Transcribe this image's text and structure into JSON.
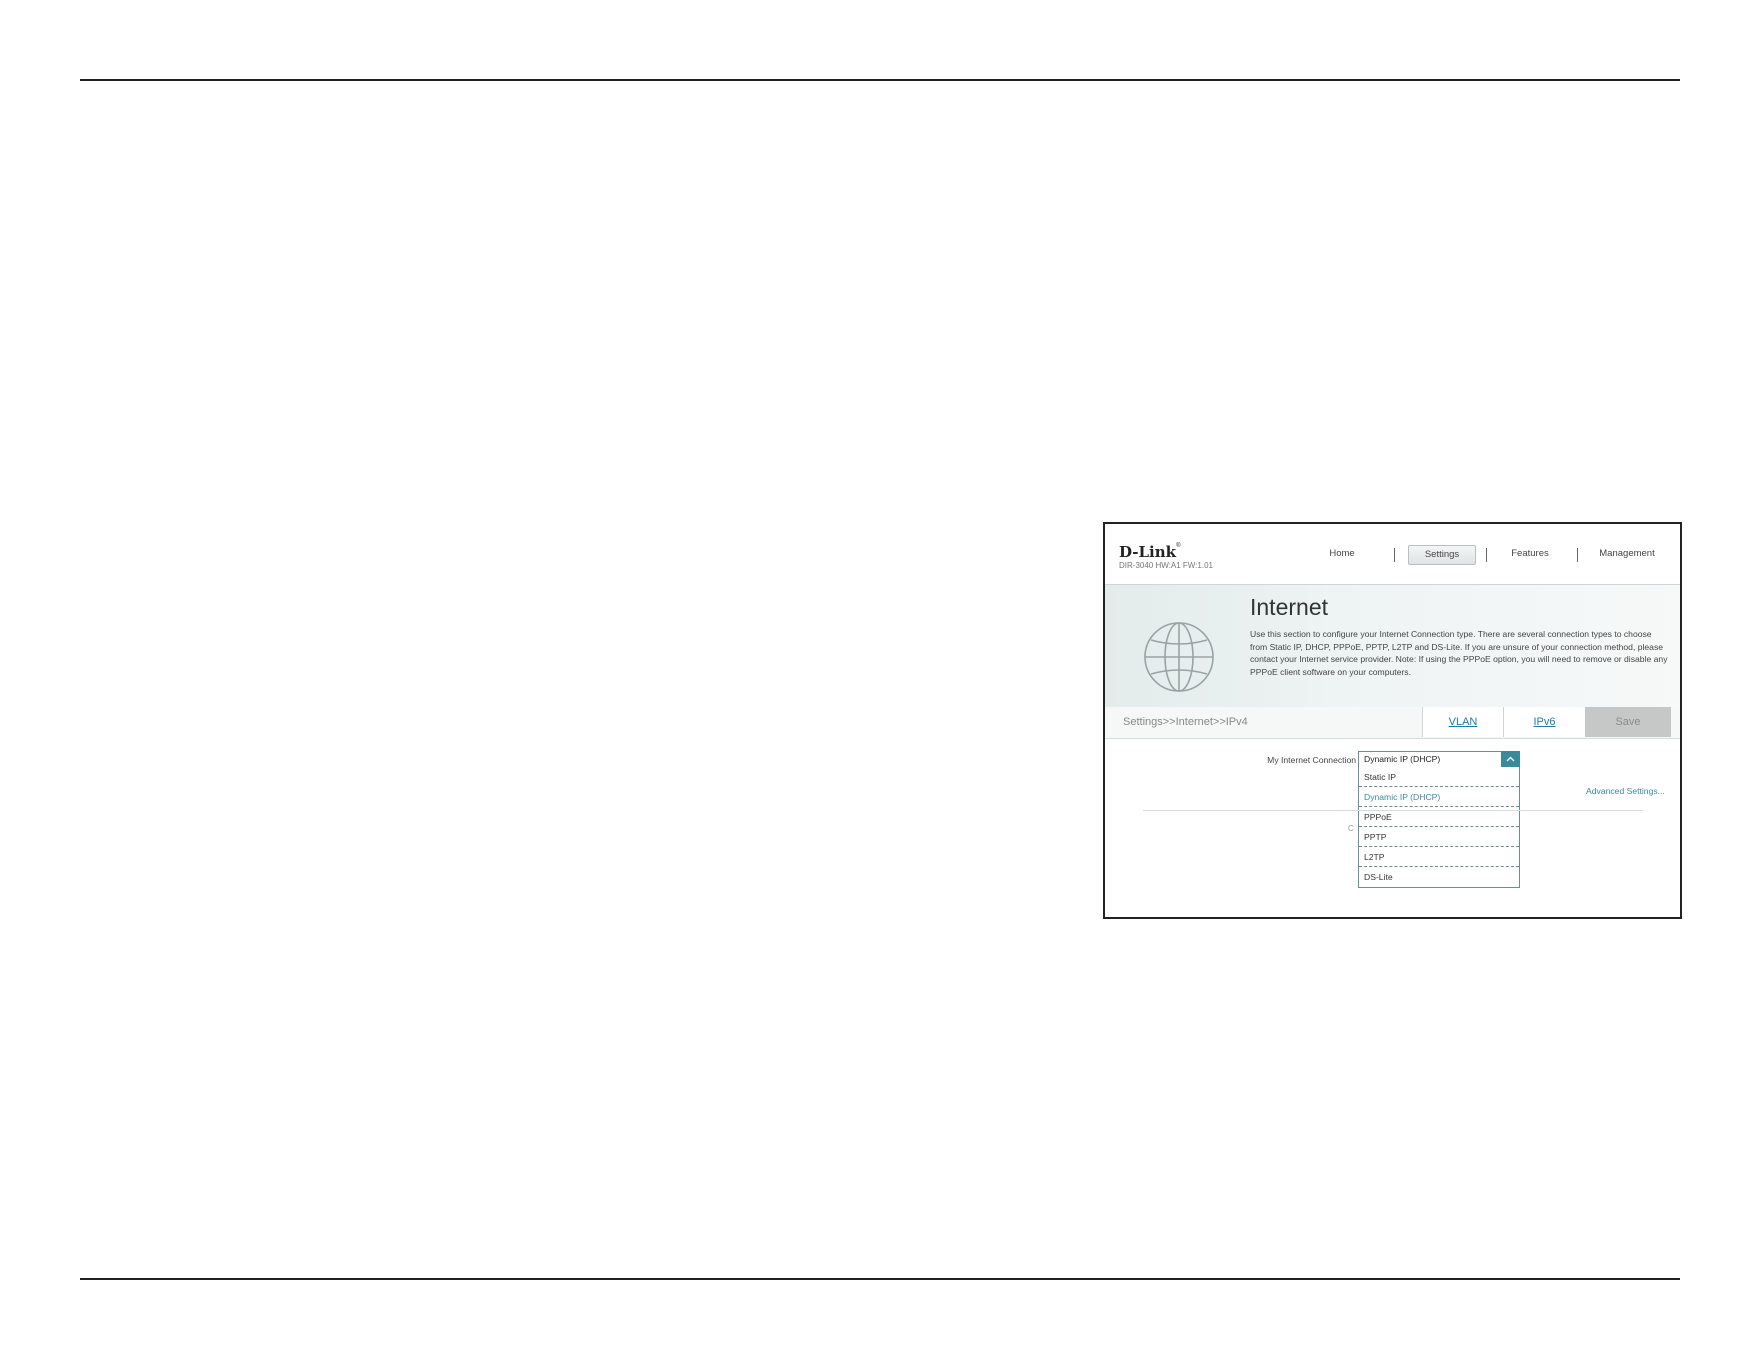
{
  "brand": {
    "logo": "D-Link",
    "trademark": "®",
    "model": "DIR-3040 HW:A1 FW:1.01"
  },
  "nav": {
    "home": "Home",
    "settings": "Settings",
    "features": "Features",
    "management": "Management",
    "active": "Settings"
  },
  "page": {
    "title": "Internet",
    "description": "Use this section to configure your Internet Connection type. There are several connection types to choose from Static IP, DHCP, PPPoE, PPTP, L2TP and DS-Lite. If you are unsure of your connection method, please contact your Internet service provider. Note: If using the PPPoE option, you will need to remove or disable any PPPoE client software on your computers."
  },
  "breadcrumb": "Settings>>Internet>>IPv4",
  "tabs": {
    "vlan": "VLAN",
    "ipv6": "IPv6",
    "save": "Save"
  },
  "connection": {
    "label": "My Internet Connection is:",
    "selected": "Dynamic IP (DHCP)",
    "options": [
      "Static IP",
      "Dynamic IP (DHCP)",
      "PPPoE",
      "PPTP",
      "L2TP",
      "DS-Lite"
    ]
  },
  "advanced_link": "Advanced Settings...",
  "hidden_fragment": "C",
  "colors": {
    "accent": "#3a8a9b",
    "link": "#1f7aa8",
    "save_bg": "#c6c8c8"
  }
}
